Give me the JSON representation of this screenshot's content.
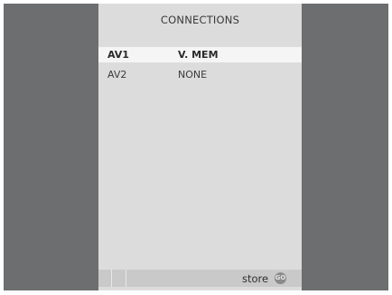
{
  "menu": {
    "title": "CONNECTIONS",
    "rows": [
      {
        "key": "AV1",
        "value": "V. MEM",
        "selected": true
      },
      {
        "key": "AV2",
        "value": "NONE",
        "selected": false
      }
    ]
  },
  "footer": {
    "action_label": "store",
    "go_label": "GO",
    "go_icon": "go-button-icon"
  },
  "colors": {
    "frame": "#6d6e70",
    "panel": "#dcdcdc",
    "highlight": "#f5f5f5",
    "footer": "#c9c9c9"
  }
}
